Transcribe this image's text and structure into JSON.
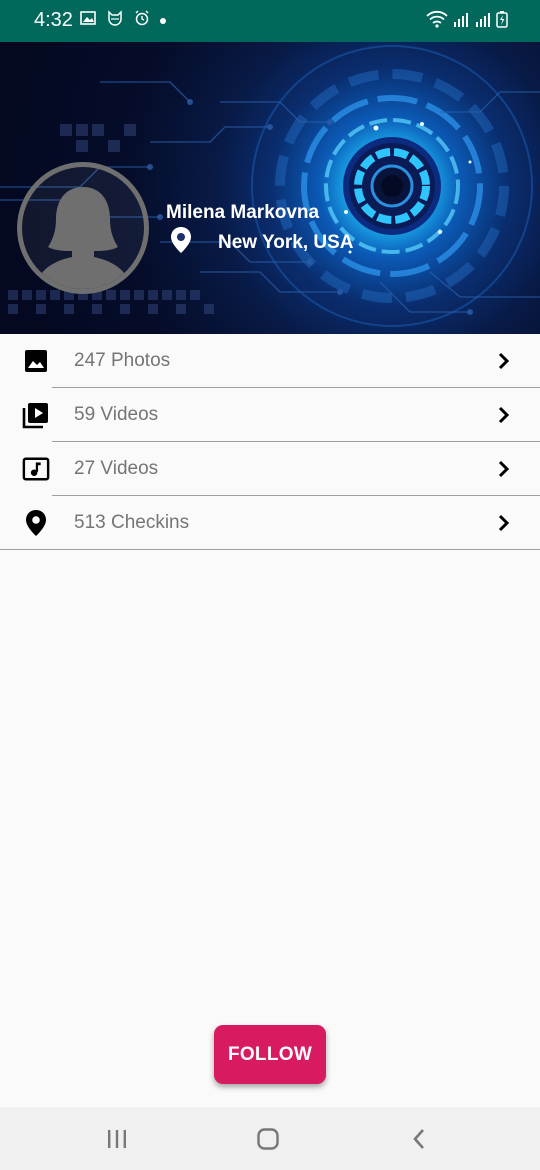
{
  "status_bar": {
    "time": "4:32",
    "icons": [
      "image-icon",
      "cat-icon",
      "alarm-icon",
      "dot-icon",
      "wifi-icon",
      "signal-icon",
      "signal-icon",
      "battery-icon"
    ],
    "background": "#00695c"
  },
  "profile": {
    "name": "Milena Markovna",
    "location": "New York, USA"
  },
  "list": {
    "items": [
      {
        "icon": "photo-icon",
        "label": "247 Photos"
      },
      {
        "icon": "video-library-icon",
        "label": "59 Videos"
      },
      {
        "icon": "music-icon",
        "label": "27 Videos"
      },
      {
        "icon": "location-pin-icon",
        "label": "513 Checkins"
      }
    ]
  },
  "follow_button": {
    "label": "FOLLOW",
    "color": "#d81b60"
  },
  "nav_bar": {
    "buttons": [
      "recent-apps-icon",
      "home-icon",
      "back-icon"
    ]
  }
}
